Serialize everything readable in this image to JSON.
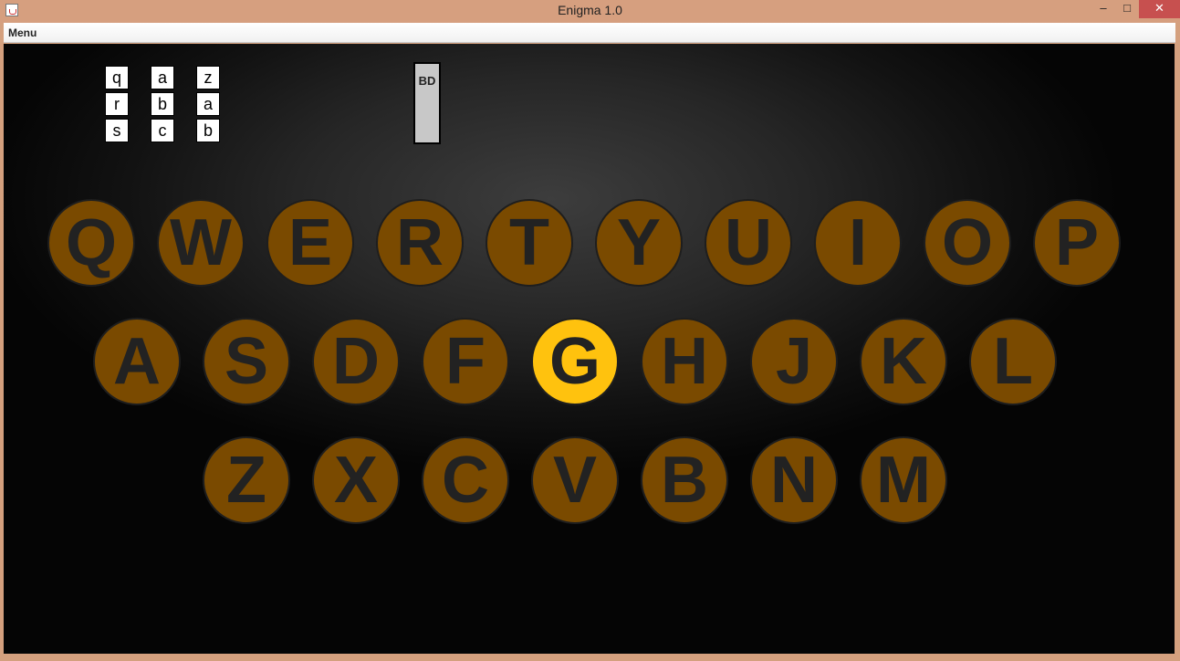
{
  "window": {
    "title": "Enigma 1.0",
    "controls": {
      "minimize": "–",
      "maximize": "□",
      "close": "✕"
    }
  },
  "menubar": {
    "menu_label": "Menu"
  },
  "rotors": [
    {
      "letters": [
        "q",
        "r",
        "s"
      ]
    },
    {
      "letters": [
        "a",
        "b",
        "c"
      ]
    },
    {
      "letters": [
        "z",
        "a",
        "b"
      ]
    }
  ],
  "plugboard": {
    "label": "BD"
  },
  "lampboard": {
    "rows": [
      [
        "Q",
        "W",
        "E",
        "R",
        "T",
        "Y",
        "U",
        "I",
        "O",
        "P"
      ],
      [
        "A",
        "S",
        "D",
        "F",
        "G",
        "H",
        "J",
        "K",
        "L"
      ],
      [
        "Z",
        "X",
        "C",
        "V",
        "B",
        "N",
        "M"
      ]
    ],
    "lit_key": "G"
  },
  "colors": {
    "key_fill": "#7a4a00",
    "key_lit_fill": "#ffc20e",
    "key_text": "#222222",
    "background": "#111111"
  }
}
